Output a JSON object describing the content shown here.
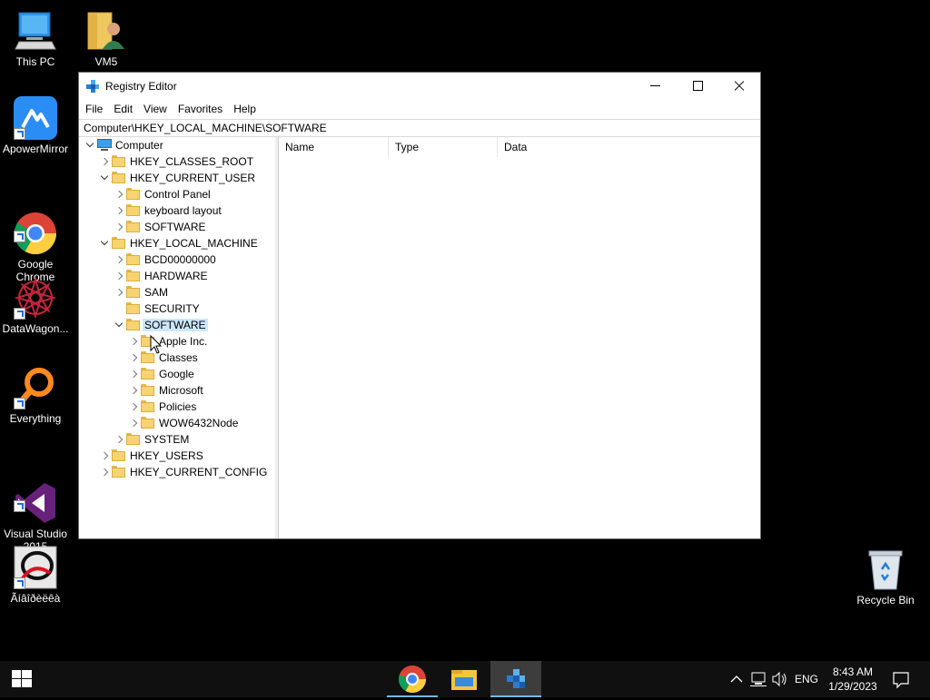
{
  "desktop": {
    "icons": [
      {
        "label": "This PC"
      },
      {
        "label": "VM5"
      },
      {
        "label": "ApowerMirror"
      },
      {
        "label": "Google\nChrome"
      },
      {
        "label": "DataWagon..."
      },
      {
        "label": "Everything"
      },
      {
        "label": "Visual Studio\n2015"
      },
      {
        "label": "Ãíâîðèëêà"
      },
      {
        "label": "Recycle Bin"
      }
    ]
  },
  "window": {
    "title": "Registry Editor",
    "menu": [
      "File",
      "Edit",
      "View",
      "Favorites",
      "Help"
    ],
    "address": "Computer\\HKEY_LOCAL_MACHINE\\SOFTWARE",
    "tree": [
      {
        "label": "Computer",
        "depth": 0,
        "state": "expanded",
        "icon": "computer-icon"
      },
      {
        "label": "HKEY_CLASSES_ROOT",
        "depth": 1,
        "state": "collapsed"
      },
      {
        "label": "HKEY_CURRENT_USER",
        "depth": 1,
        "state": "expanded"
      },
      {
        "label": "Control Panel",
        "depth": 2,
        "state": "collapsed"
      },
      {
        "label": "keyboard layout",
        "depth": 2,
        "state": "collapsed"
      },
      {
        "label": "SOFTWARE",
        "depth": 2,
        "state": "collapsed"
      },
      {
        "label": "HKEY_LOCAL_MACHINE",
        "depth": 1,
        "state": "expanded"
      },
      {
        "label": "BCD00000000",
        "depth": 2,
        "state": "collapsed"
      },
      {
        "label": "HARDWARE",
        "depth": 2,
        "state": "collapsed"
      },
      {
        "label": "SAM",
        "depth": 2,
        "state": "collapsed"
      },
      {
        "label": "SECURITY",
        "depth": 2,
        "state": "leaf"
      },
      {
        "label": "SOFTWARE",
        "depth": 2,
        "state": "expanded",
        "selected": true
      },
      {
        "label": "Apple Inc.",
        "depth": 3,
        "state": "collapsed"
      },
      {
        "label": "Classes",
        "depth": 3,
        "state": "collapsed"
      },
      {
        "label": "Google",
        "depth": 3,
        "state": "collapsed"
      },
      {
        "label": "Microsoft",
        "depth": 3,
        "state": "collapsed"
      },
      {
        "label": "Policies",
        "depth": 3,
        "state": "collapsed"
      },
      {
        "label": "WOW6432Node",
        "depth": 3,
        "state": "collapsed"
      },
      {
        "label": "SYSTEM",
        "depth": 2,
        "state": "collapsed"
      },
      {
        "label": "HKEY_USERS",
        "depth": 1,
        "state": "collapsed"
      },
      {
        "label": "HKEY_CURRENT_CONFIG",
        "depth": 1,
        "state": "collapsed"
      }
    ],
    "columns": [
      "Name",
      "Type",
      "Data"
    ]
  },
  "taskbar": {
    "apps": [
      "chrome-icon",
      "file-explorer-icon",
      "registry-editor-icon"
    ],
    "tray": {
      "language": "ENG",
      "time": "8:43 AM",
      "date": "1/29/2023"
    }
  }
}
